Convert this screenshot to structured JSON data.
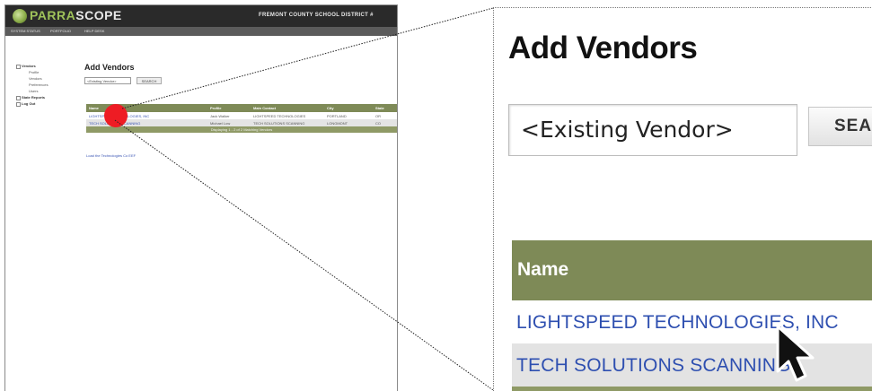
{
  "thumbnail": {
    "logo": {
      "prefix": "PARRA",
      "suffix": "SCOPE"
    },
    "district": "FREMONT COUNTY SCHOOL DISTRICT #",
    "nav": [
      "SYSTEM STATUS",
      "PORTFOLIO",
      "HELP DESK"
    ],
    "sidebar": [
      {
        "label": "Vendors",
        "kind": "group"
      },
      {
        "label": "Profile",
        "kind": "sub"
      },
      {
        "label": "Vendors",
        "kind": "sub"
      },
      {
        "label": "Preferences",
        "kind": "sub"
      },
      {
        "label": "Users",
        "kind": "sub"
      },
      {
        "label": "State Reports",
        "kind": "group"
      },
      {
        "label": "Log Out",
        "kind": "group"
      }
    ],
    "title": "Add Vendors",
    "search_value": "<Existing Vendor>",
    "search_button": "SEARCH",
    "columns": [
      "Name",
      "Profile",
      "Main Contact",
      "City",
      "State"
    ],
    "rows": [
      [
        "LIGHTSPEED TECHNOLOGIES, INC",
        "Jack Walker",
        "LIGHTSPEED TECHNOLOGIES",
        "PORTLAND",
        "OR"
      ],
      [
        "TECH SOLUTIONS SCANNING",
        "Michael Low",
        "TECH SOLUTIONS SCANNING",
        "LONGMONT",
        "CO"
      ]
    ],
    "footer": "Displaying 1 - 2 of 2 Matching Vendors",
    "new_link": "Load the Technologies Co EEF"
  },
  "zoom": {
    "title": "Add Vendors",
    "search_value": "<Existing Vendor>",
    "search_button": "SEARCH",
    "column_name": "Name",
    "rows": [
      "LIGHTSPEED TECHNOLOGIES, INC",
      "TECH SOLUTIONS SCANNING"
    ]
  },
  "colors": {
    "header_bg": "#2a2a2a",
    "table_header": "#7e8a57",
    "link": "#2e4fb0",
    "marker": "#ee1c24"
  }
}
